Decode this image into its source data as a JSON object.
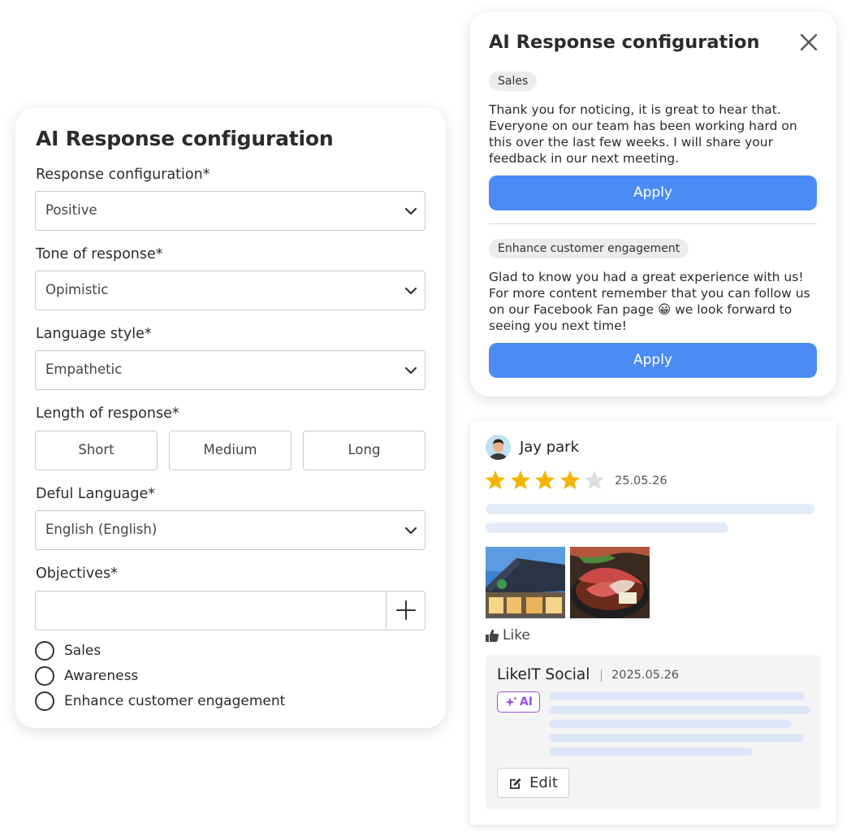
{
  "config": {
    "title": "AI Response configuration",
    "response_configuration": {
      "label": "Response configuration*",
      "value": "Positive"
    },
    "tone": {
      "label": "Tone of response*",
      "value": "Opimistic"
    },
    "language_style": {
      "label": "Language style*",
      "value": "Empathetic"
    },
    "length": {
      "label": "Length of response*",
      "options": [
        "Short",
        "Medium",
        "Long"
      ]
    },
    "default_language": {
      "label": "Deful Language*",
      "value": "English (English)"
    },
    "objectives": {
      "label": "Objectives*",
      "input_value": "",
      "options": [
        "Sales",
        "Awareness",
        "Enhance customer engagement"
      ]
    }
  },
  "responses": {
    "title": "AI Response configuration",
    "items": [
      {
        "tag": "Sales",
        "text": "Thank you for noticing, it is great to hear that. Everyone on our team has been working hard on this over the last few weeks. I will share your feedback in our next meeting.",
        "apply_label": "Apply"
      },
      {
        "tag": "Enhance customer engagement",
        "text": "Glad to know you had a great experience with us! For more content remember that you can follow us on our Facebook Fan page 😀 we look forward to seeing you next time!",
        "apply_label": "Apply"
      }
    ],
    "accent_color": "#4b8bf5"
  },
  "review": {
    "reviewer": "Jay park",
    "rating": 4,
    "rating_max": 5,
    "date": "25.05.26",
    "like_label": "Like",
    "reply": {
      "author": "LikeIT Social",
      "date": "2025.05.26",
      "ai_badge": "AI",
      "edit_label": "Edit"
    },
    "star_color": "#f5b400",
    "ai_color": "#9b51e0"
  }
}
